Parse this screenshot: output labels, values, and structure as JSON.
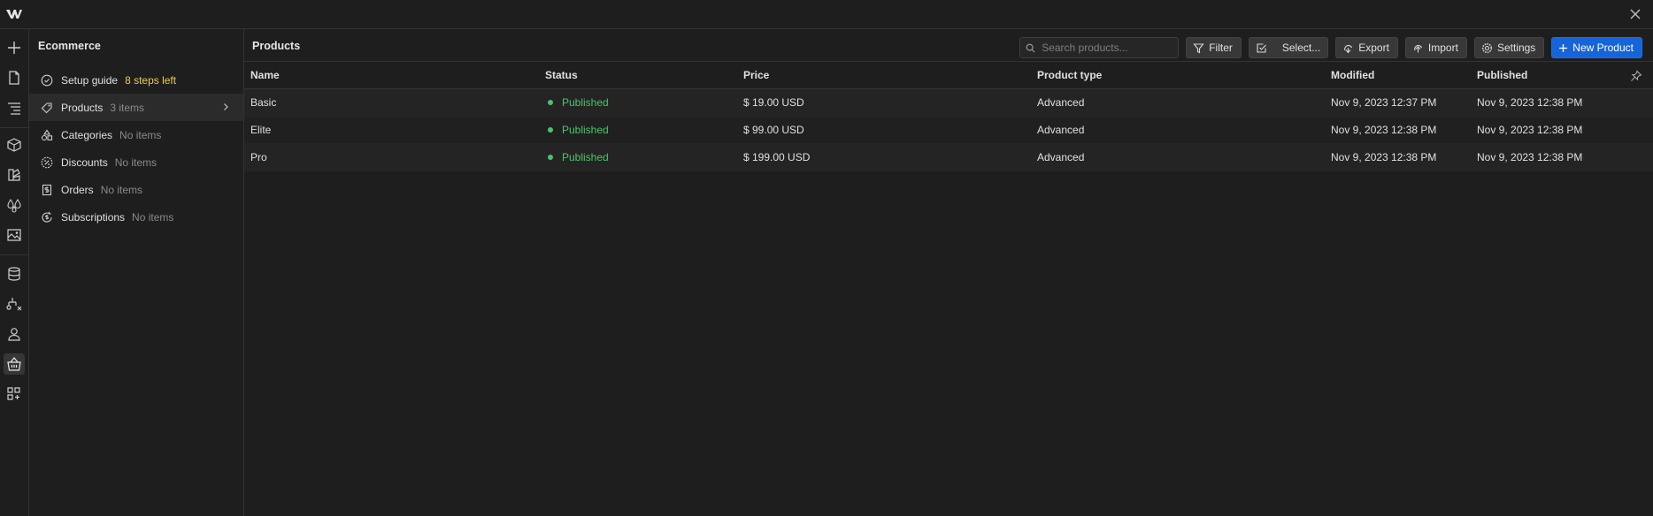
{
  "panel": {
    "title": "Ecommerce",
    "items": [
      {
        "label": "Setup guide",
        "meta": "8 steps left"
      },
      {
        "label": "Products",
        "meta": "3 items"
      },
      {
        "label": "Categories",
        "meta": "No items"
      },
      {
        "label": "Discounts",
        "meta": "No items"
      },
      {
        "label": "Orders",
        "meta": "No items"
      },
      {
        "label": "Subscriptions",
        "meta": "No items"
      }
    ]
  },
  "main": {
    "title": "Products",
    "search_placeholder": "Search products...",
    "buttons": {
      "filter": "Filter",
      "select": "Select...",
      "export": "Export",
      "import": "Import",
      "settings": "Settings",
      "new_product": "New Product"
    }
  },
  "table": {
    "columns": [
      "Name",
      "Status",
      "Price",
      "Product type",
      "Modified",
      "Published"
    ],
    "rows": [
      {
        "name": "Basic",
        "status": "Published",
        "price": "$ 19.00 USD",
        "type": "Advanced",
        "modified": "Nov 9, 2023 12:37 PM",
        "published": "Nov 9, 2023 12:38 PM"
      },
      {
        "name": "Elite",
        "status": "Published",
        "price": "$ 99.00 USD",
        "type": "Advanced",
        "modified": "Nov 9, 2023 12:38 PM",
        "published": "Nov 9, 2023 12:38 PM"
      },
      {
        "name": "Pro",
        "status": "Published",
        "price": "$ 199.00 USD",
        "type": "Advanced",
        "modified": "Nov 9, 2023 12:38 PM",
        "published": "Nov 9, 2023 12:38 PM"
      }
    ]
  },
  "colors": {
    "accent": "#1665d8",
    "published": "#4cc36b",
    "warning": "#f2c94c"
  }
}
